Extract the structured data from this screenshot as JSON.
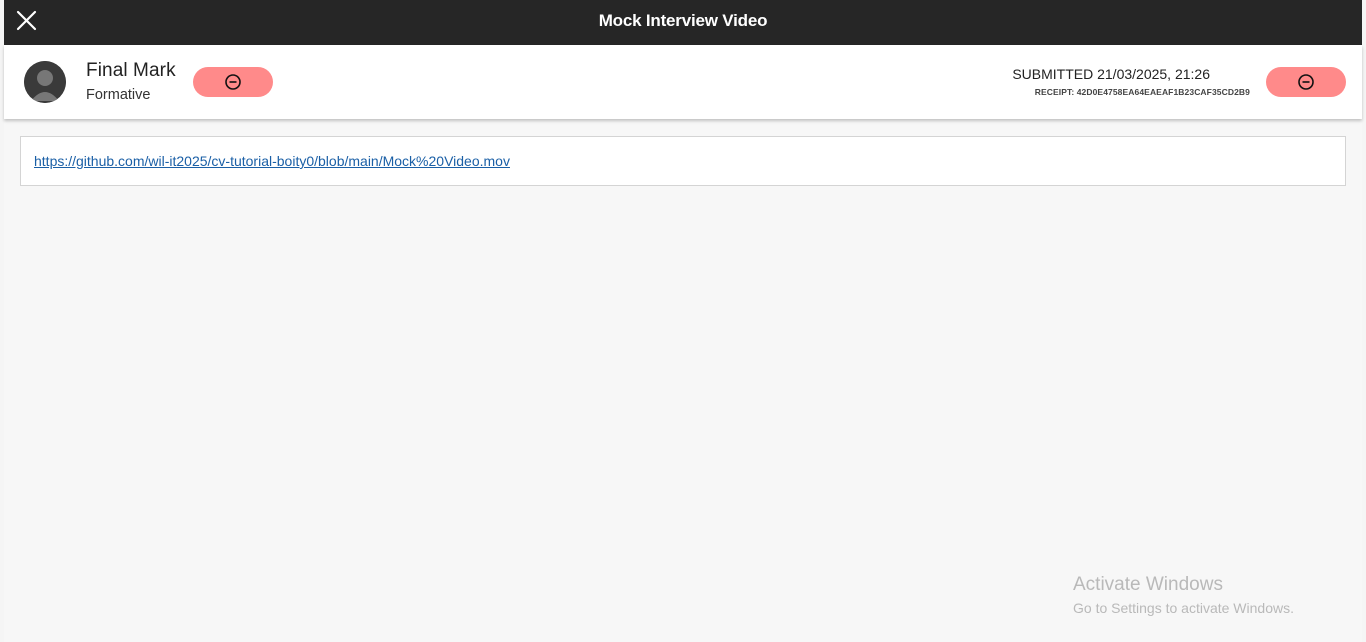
{
  "window": {
    "title": "Mock Interview Video",
    "close_icon": "close-icon"
  },
  "header": {
    "avatar_icon": "user-avatar-icon",
    "mark_title": "Final Mark",
    "mark_subtitle": "Formative",
    "left_action_icon": "minus-circle-icon",
    "submitted_text": "SUBMITTED 21/03/2025, 21:26",
    "receipt_text": "RECEIPT: 42D0E4758EA64EAEAF1B23CAF35CD2B9",
    "right_action_icon": "minus-circle-icon"
  },
  "content": {
    "link_text": "https://github.com/wil-it2025/cv-tutorial-boity0/blob/main/Mock%20Video.mov"
  },
  "watermark": {
    "title": "Activate Windows",
    "subtitle": "Go to Settings to activate Windows."
  },
  "colors": {
    "titlebar": "#262626",
    "pill": "#ff8a8a",
    "link": "#1a5fa6"
  }
}
